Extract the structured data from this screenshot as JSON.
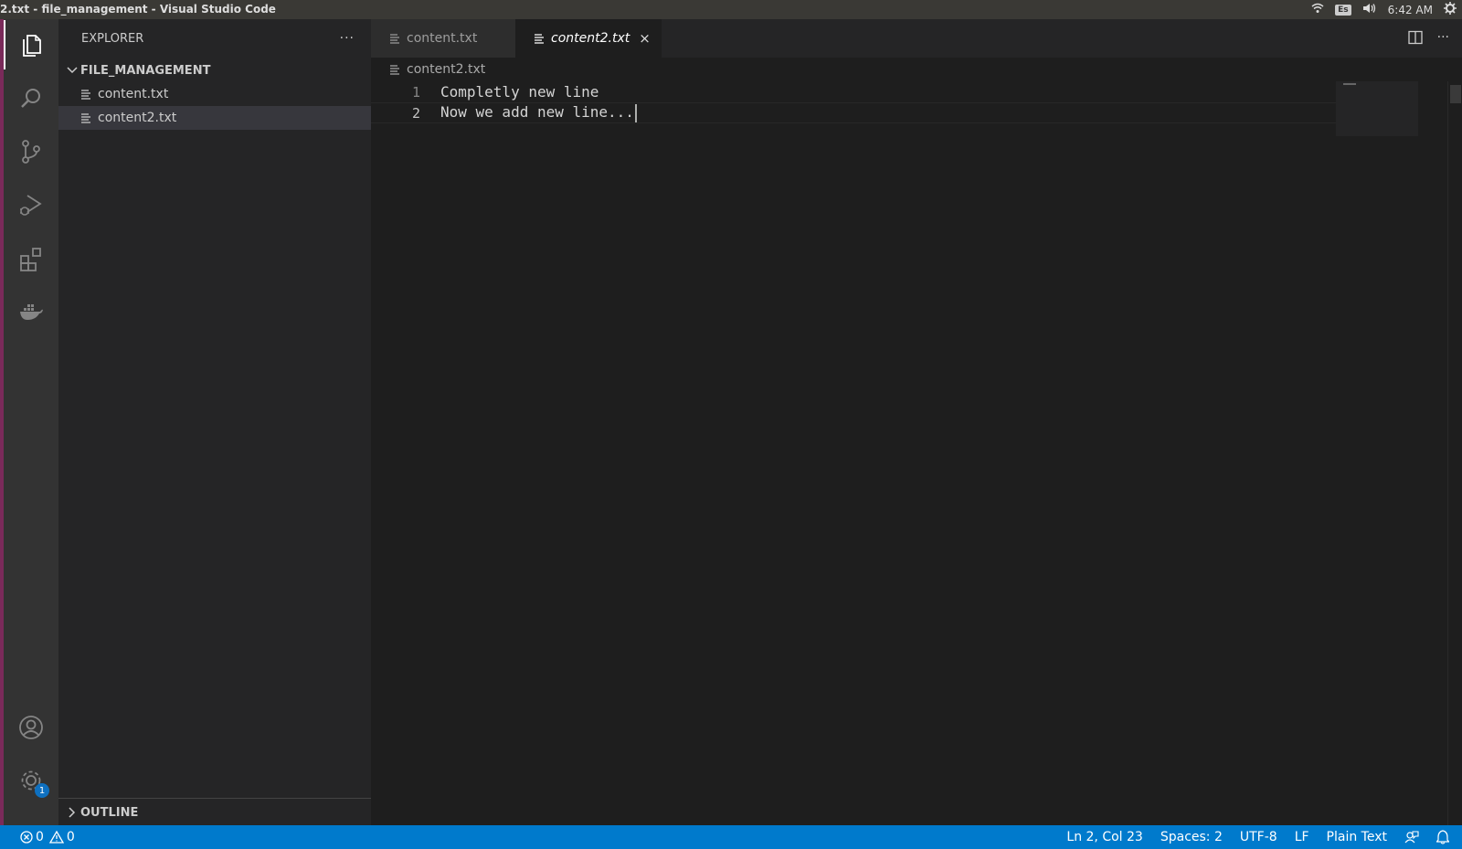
{
  "window": {
    "title": "2.txt - file_management - Visual Studio Code",
    "keyboard_layout": "Es",
    "clock": "6:42 AM"
  },
  "activity_bar": {
    "items": [
      "explorer",
      "search",
      "source-control",
      "run-debug",
      "extensions",
      "docker"
    ],
    "settings_badge": "1"
  },
  "sidebar": {
    "title": "EXPLORER",
    "more": "···",
    "folder": "FILE_MANAGEMENT",
    "files": [
      {
        "name": "content.txt"
      },
      {
        "name": "content2.txt"
      }
    ],
    "outline": "OUTLINE"
  },
  "editor": {
    "tabs": [
      {
        "label": "content.txt"
      },
      {
        "label": "content2.txt",
        "close": "×"
      }
    ],
    "tab_more": "···",
    "breadcrumb": "content2.txt",
    "lines": [
      {
        "number": "1",
        "text": "Completly new line"
      },
      {
        "number": "2",
        "text": "Now we add new line..."
      }
    ]
  },
  "statusbar": {
    "errors": "0",
    "warnings": "0",
    "position": "Ln 2, Col 23",
    "spaces": "Spaces: 2",
    "encoding": "UTF-8",
    "eol": "LF",
    "language": "Plain Text"
  },
  "colors": {
    "statusbar": "#007acc",
    "activitybar": "#333333",
    "sidebar": "#252526",
    "editor": "#1e1e1e"
  }
}
